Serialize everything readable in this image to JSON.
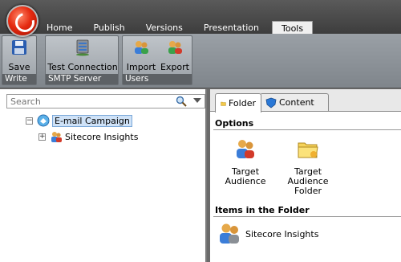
{
  "tabs": [
    "Home",
    "Publish",
    "Versions",
    "Presentation",
    "Tools"
  ],
  "active_tab": "Tools",
  "ribbon": {
    "groups": [
      {
        "label": "Write",
        "buttons": [
          "Save"
        ]
      },
      {
        "label": "SMTP Server",
        "buttons": [
          "Test Connection"
        ]
      },
      {
        "label": "Users",
        "buttons": [
          "Import",
          "Export"
        ]
      }
    ]
  },
  "search": {
    "placeholder": "Search"
  },
  "tree": {
    "root": "E-mail Campaign",
    "child": "Sitecore Insights"
  },
  "content_tabs": [
    "Folder",
    "Content"
  ],
  "options": {
    "heading": "Options",
    "items": [
      {
        "label_lines": [
          "Target",
          "Audience"
        ]
      },
      {
        "label_lines": [
          "Target",
          "Audience",
          "Folder"
        ]
      }
    ]
  },
  "folder": {
    "heading": "Items in the Folder",
    "items": [
      "Sitecore Insights"
    ]
  },
  "colors": {
    "accent_red": "#e52a10",
    "selection": "#cfe2f7"
  }
}
